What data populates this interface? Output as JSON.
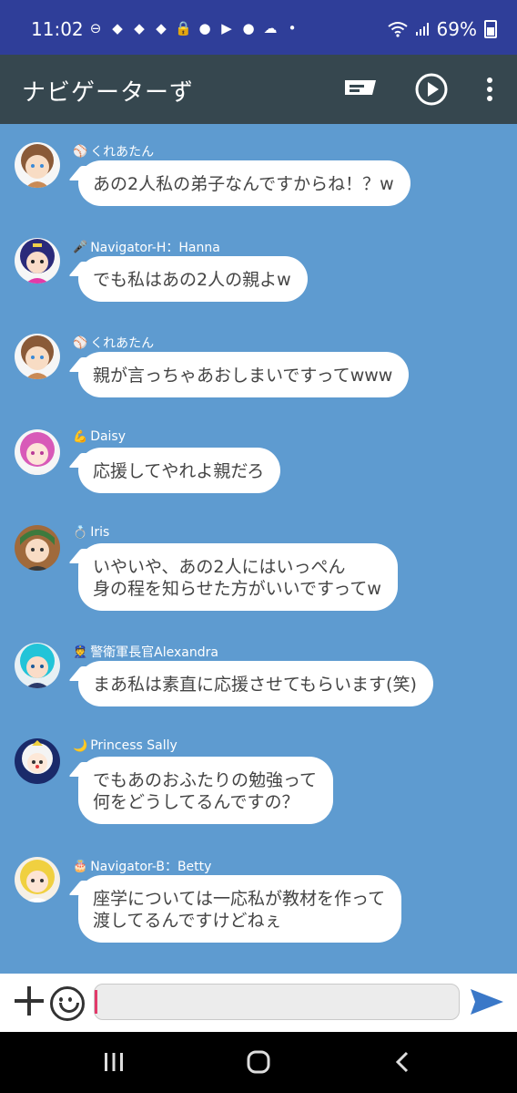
{
  "status": {
    "time": "11:02",
    "battery": "69%",
    "icons": [
      "minus-circle-icon",
      "game-icon",
      "game-icon",
      "game-icon",
      "lock-icon",
      "line-icon",
      "youtube-icon",
      "account-icon",
      "cloud-icon",
      "dot-icon"
    ]
  },
  "header": {
    "title": "ナビゲーターず"
  },
  "messages": [
    {
      "sender": "くれあたん",
      "emoji": "⚾",
      "lines": [
        "あの2人私の弟子なんですからね！？w"
      ],
      "avatar_color": "#c98a55",
      "hair": "#8a5a38"
    },
    {
      "sender": "Navigator-H：Hanna",
      "emoji": "🎤",
      "lines": [
        "でも私はあの2人の親よw"
      ],
      "avatar_color": "#f0d04a",
      "hair": "#2a2a7a"
    },
    {
      "sender": "くれあたん",
      "emoji": "⚾",
      "lines": [
        "親が言っちゃあおしまいですってwww"
      ],
      "avatar_color": "#c98a55",
      "hair": "#8a5a38"
    },
    {
      "sender": "Daisy",
      "emoji": "💪",
      "lines": [
        "応援してやれよ親だろ"
      ],
      "avatar_color": "#f4f4f4",
      "hair": "#d85ab8"
    },
    {
      "sender": "Iris",
      "emoji": "💍",
      "lines": [
        "いやいや、あの2人にはいっぺん",
        "身の程を知らせた方がいいですってw"
      ],
      "avatar_color": "#a06a3c",
      "hair": "#3d7a3d"
    },
    {
      "sender": "警衛軍長官Alexandra",
      "emoji": "👮",
      "lines": [
        "まあ私は素直に応援させてもらいます(笑)"
      ],
      "avatar_color": "#e8f0f4",
      "hair": "#22c4d8"
    },
    {
      "sender": "Princess Sally",
      "emoji": "🌙",
      "lines": [
        "でもあのおふたりの勉強って",
        "何をどうしてるんですの？"
      ],
      "avatar_color": "#1a2a6a",
      "hair": "#f4f4f4"
    },
    {
      "sender": "Navigator-B：Betty",
      "emoji": "🎂",
      "lines": [
        "座学については一応私が教材を作って",
        "渡してるんですけどねぇ"
      ],
      "avatar_color": "#f6f0e6",
      "hair": "#f0d040"
    }
  ],
  "composer": {
    "placeholder": ""
  },
  "colors": {
    "status_bar": "#2f3e99",
    "app_bar": "#36474f",
    "chat_bg": "#5e9bd0",
    "send": "#3a78c8",
    "cursor": "#e23a6a"
  }
}
